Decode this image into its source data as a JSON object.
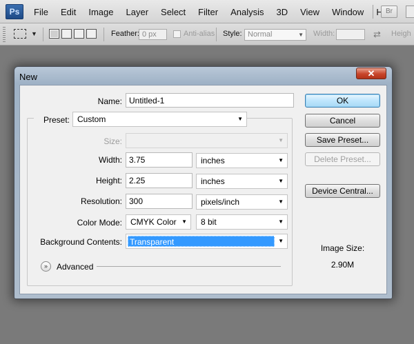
{
  "app": {
    "logo": "Ps"
  },
  "menubar": {
    "items": [
      "File",
      "Edit",
      "Image",
      "Layer",
      "Select",
      "Filter",
      "Analysis",
      "3D",
      "View",
      "Window",
      "Help"
    ],
    "bridge_button": "Br"
  },
  "options_bar": {
    "feather_label": "Feather:",
    "feather_value": "0 px",
    "antialias_label": "Anti-alias",
    "style_label": "Style:",
    "style_value": "Normal",
    "width_label": "Width:",
    "height_label": "Heigh"
  },
  "dialog": {
    "title": "New",
    "close_glyph": "✕",
    "name_label": "Name:",
    "name_value": "Untitled-1",
    "preset_label": "Preset:",
    "preset_value": "Custom",
    "size_label": "Size:",
    "size_value": "",
    "width_label": "Width:",
    "width_value": "3.75",
    "width_unit": "inches",
    "height_label": "Height:",
    "height_value": "2.25",
    "height_unit": "inches",
    "resolution_label": "Resolution:",
    "resolution_value": "300",
    "resolution_unit": "pixels/inch",
    "color_mode_label": "Color Mode:",
    "color_mode_value": "CMYK Color",
    "bit_depth_value": "8 bit",
    "background_label": "Background Contents:",
    "background_value": "Transparent",
    "advanced_label": "Advanced",
    "buttons": {
      "ok": "OK",
      "cancel": "Cancel",
      "save_preset": "Save Preset...",
      "delete_preset": "Delete Preset...",
      "device_central": "Device Central..."
    },
    "image_size_label": "Image Size:",
    "image_size_value": "2.90M"
  },
  "colors": {
    "workspace": "#7a7a7a",
    "selection": "#3399ff",
    "close_button": "#c8452a",
    "title_bar": "#9fb2c6"
  }
}
